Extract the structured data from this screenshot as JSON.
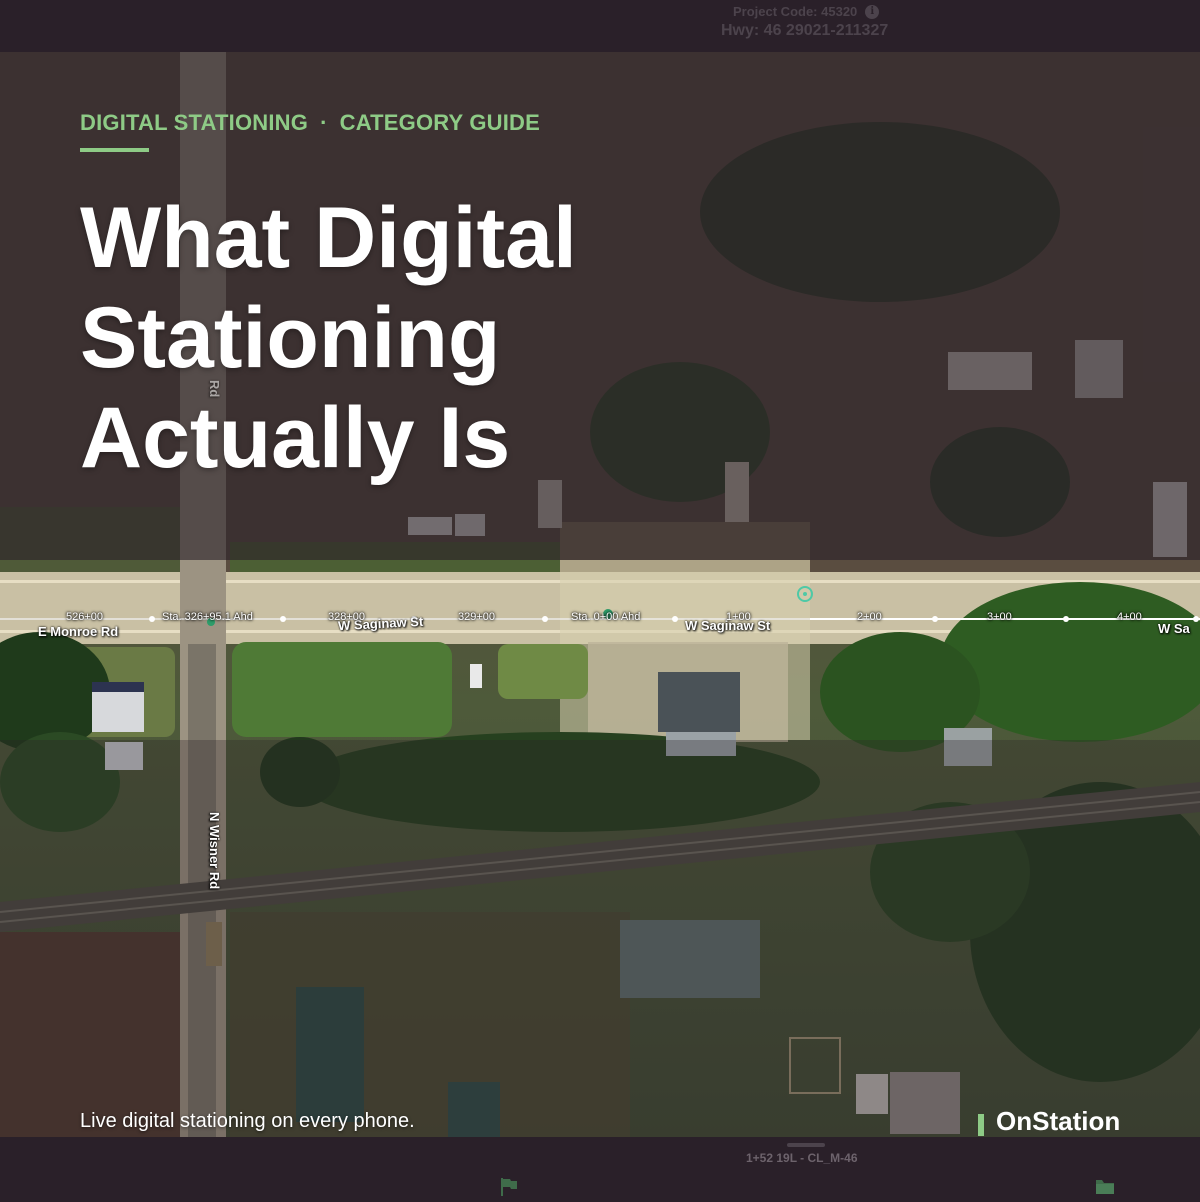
{
  "header": {
    "project_code": "Project Code: 45320",
    "info_icon": "i",
    "highway": "Hwy: 46 29021-211327"
  },
  "overlay": {
    "eyebrow_left": "DIGITAL STATIONING",
    "eyebrow_separator": "·",
    "eyebrow_right": "CATEGORY GUIDE",
    "headline": [
      "What Digital",
      "Stationing",
      "Actually Is"
    ],
    "tagline": "Live digital stationing on every phone.",
    "brand": "OnStation"
  },
  "map": {
    "road_names": {
      "e_monroe": "E Monroe Rd",
      "w_saginaw_1": "W Saginaw St",
      "w_saginaw_2": "W Saginaw St",
      "w_saginaw_3": "W Sa",
      "n_wisner": "N Wisner Rd",
      "rd_fragment": "Rd"
    },
    "stations": {
      "s526": "526+00",
      "sta_a": "Sta. 326+95.1 Ahd",
      "s328": "328+00",
      "s329": "329+00",
      "sta_b": "Sta. 0+00 Ahd",
      "s1": "1+00",
      "s2": "2+00",
      "s3": "3+00",
      "s4": "4+00"
    }
  },
  "footer": {
    "station_readout": "1+52 19L - CL_M-46",
    "flag_icon": "flag-icon",
    "folder_icon": "folder-icon"
  },
  "colors": {
    "accent": "#8ecb86",
    "background": "#2a2029",
    "muted_text": "#4c434c",
    "target": "#4ec9a6"
  }
}
